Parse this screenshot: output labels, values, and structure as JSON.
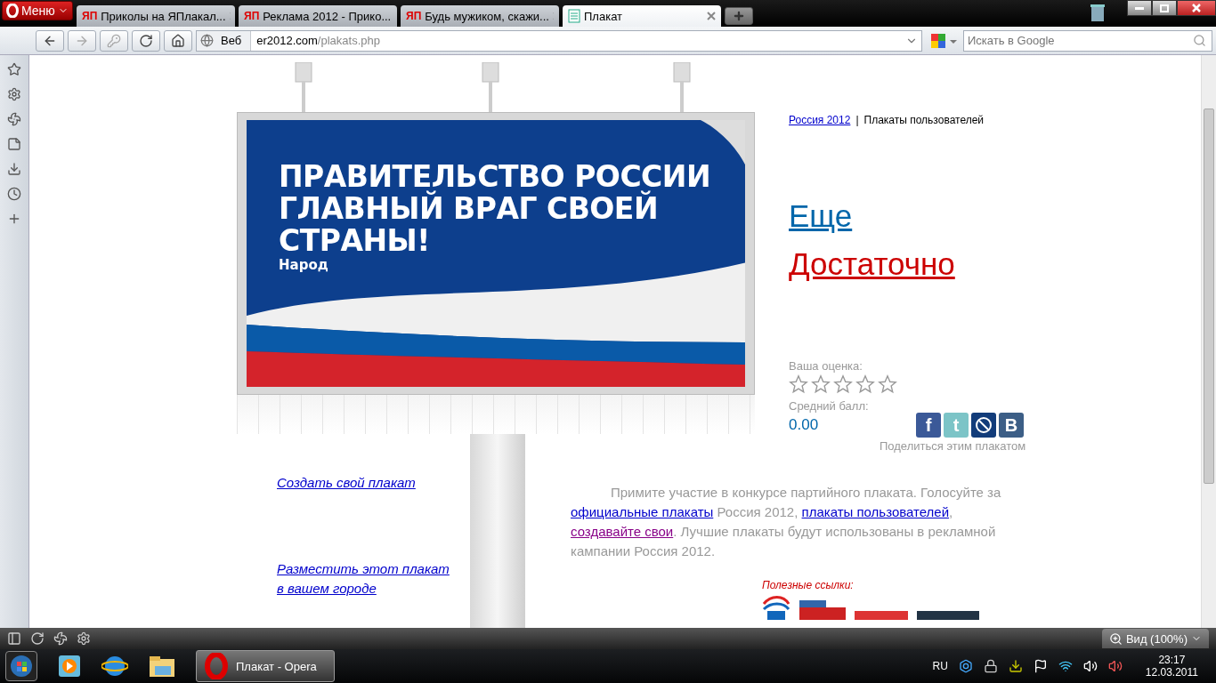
{
  "browser": {
    "menu_label": "Меню",
    "tabs": [
      {
        "site_mark": "ЯП",
        "label": "Приколы на ЯПлакал...",
        "selected": false
      },
      {
        "site_mark": "ЯП",
        "label": "Реклама 2012 - Прико...",
        "selected": false
      },
      {
        "site_mark": "ЯП",
        "label": "Будь мужиком, скажи...",
        "selected": false
      },
      {
        "label": "Плакат",
        "selected": true
      }
    ],
    "scope_label": "Веб",
    "address": {
      "host": "er2012.com",
      "path": "/plakats.php"
    },
    "search": {
      "placeholder": "Искать в Google"
    }
  },
  "poster": {
    "headline_lines": [
      "ПРАВИТЕЛЬСТВО РОССИИ",
      "ГЛАВНЫЙ ВРАГ СВОЕЙ",
      "СТРАНЫ!"
    ],
    "signature": "Народ"
  },
  "side_links": [
    "Создать свой плакат",
    "Разместить этот плакат в вашем городе"
  ],
  "breadcrumb": {
    "link": "Россия 2012",
    "separator": "|",
    "current": "Плакаты пользователей"
  },
  "more_link": "Еще",
  "enough_link": "Достаточно",
  "rating": {
    "label": "Ваша оценка:",
    "stars": 0,
    "average_label": "Средний балл:",
    "average": "0.00",
    "share_label": "Поделиться этим плакатом"
  },
  "share_buttons": [
    {
      "kind": "facebook",
      "glyph": "f"
    },
    {
      "kind": "twitter",
      "glyph": "t"
    },
    {
      "kind": "journal"
    },
    {
      "kind": "vk",
      "glyph": "B"
    }
  ],
  "intro": [
    {
      "text": "Примите участие в конкурсе партийного плаката. Голосуйте за "
    },
    {
      "text": "официальные плакаты",
      "link": true,
      "visited": false
    },
    {
      "text": " Россия 2012, "
    },
    {
      "text": "плакаты пользователей",
      "link": true,
      "visited": false
    },
    {
      "text": ", "
    },
    {
      "text": "создавайте свои",
      "link": true,
      "visited": true
    },
    {
      "text": ". Лучшие плакаты будут использованы в рекламной кампании Россия 2012."
    }
  ],
  "useful_links_label": "Полезные ссылки:",
  "status_bar": {
    "zoom": "Вид (100%)"
  },
  "taskbar": {
    "window_label": "Плакат - Opera",
    "language": "RU",
    "time": "23:17",
    "date": "12.03.2011"
  }
}
